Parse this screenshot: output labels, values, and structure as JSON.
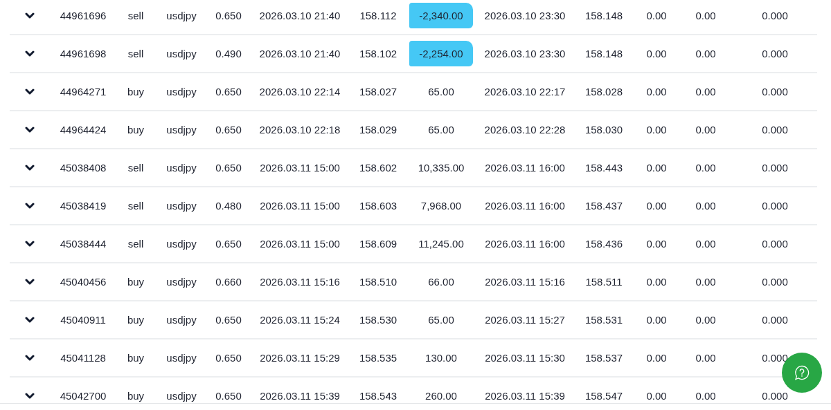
{
  "rows": [
    {
      "cells": [
        "44961696",
        "sell",
        "usdjpy",
        "0.650",
        "2026.03.10 21:40",
        "158.112",
        "-2,340.00",
        "2026.03.10 23:30",
        "158.148",
        "0.00",
        "0.00",
        "0.000"
      ],
      "marked": true
    },
    {
      "cells": [
        "44961698",
        "sell",
        "usdjpy",
        "0.490",
        "2026.03.10 21:40",
        "158.102",
        "-2,254.00",
        "2026.03.10 23:30",
        "158.148",
        "0.00",
        "0.00",
        "0.000"
      ],
      "marked": true
    },
    {
      "cells": [
        "44964271",
        "buy",
        "usdjpy",
        "0.650",
        "2026.03.10 22:14",
        "158.027",
        "65.00",
        "2026.03.10 22:17",
        "158.028",
        "0.00",
        "0.00",
        "0.000"
      ],
      "marked": false
    },
    {
      "cells": [
        "44964424",
        "buy",
        "usdjpy",
        "0.650",
        "2026.03.10 22:18",
        "158.029",
        "65.00",
        "2026.03.10 22:28",
        "158.030",
        "0.00",
        "0.00",
        "0.000"
      ],
      "marked": false
    },
    {
      "cells": [
        "45038408",
        "sell",
        "usdjpy",
        "0.650",
        "2026.03.11 15:00",
        "158.602",
        "10,335.00",
        "2026.03.11 16:00",
        "158.443",
        "0.00",
        "0.00",
        "0.000"
      ],
      "marked": false
    },
    {
      "cells": [
        "45038419",
        "sell",
        "usdjpy",
        "0.480",
        "2026.03.11 15:00",
        "158.603",
        "7,968.00",
        "2026.03.11 16:00",
        "158.437",
        "0.00",
        "0.00",
        "0.000"
      ],
      "marked": false
    },
    {
      "cells": [
        "45038444",
        "sell",
        "usdjpy",
        "0.650",
        "2026.03.11 15:00",
        "158.609",
        "11,245.00",
        "2026.03.11 16:00",
        "158.436",
        "0.00",
        "0.00",
        "0.000"
      ],
      "marked": false
    },
    {
      "cells": [
        "45040456",
        "buy",
        "usdjpy",
        "0.660",
        "2026.03.11 15:16",
        "158.510",
        "66.00",
        "2026.03.11 15:16",
        "158.511",
        "0.00",
        "0.00",
        "0.000"
      ],
      "marked": false
    },
    {
      "cells": [
        "45040911",
        "buy",
        "usdjpy",
        "0.650",
        "2026.03.11 15:24",
        "158.530",
        "65.00",
        "2026.03.11 15:27",
        "158.531",
        "0.00",
        "0.00",
        "0.000"
      ],
      "marked": false
    },
    {
      "cells": [
        "45041128",
        "buy",
        "usdjpy",
        "0.650",
        "2026.03.11 15:29",
        "158.535",
        "130.00",
        "2026.03.11 15:30",
        "158.537",
        "0.00",
        "0.00",
        "0.000"
      ],
      "marked": false
    },
    {
      "cells": [
        "45042700",
        "buy",
        "usdjpy",
        "0.650",
        "2026.03.11 15:39",
        "158.543",
        "260.00",
        "2026.03.11 15:39",
        "158.547",
        "0.00",
        "0.00",
        "0.000"
      ],
      "marked": false
    }
  ]
}
